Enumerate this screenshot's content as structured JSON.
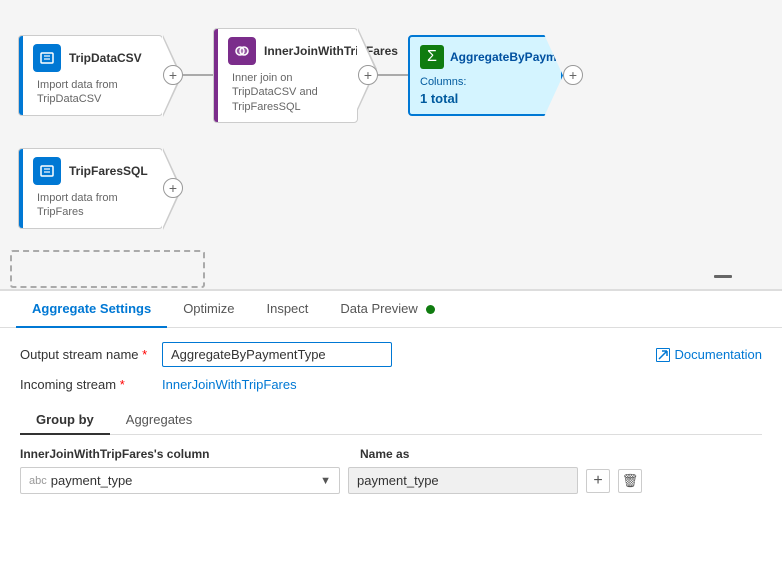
{
  "canvas": {
    "nodes": [
      {
        "id": "trip-data-csv",
        "title": "TripDataCSV",
        "subtitle": "Import data from TripDataCSV",
        "icon_type": "blue"
      },
      {
        "id": "inner-join",
        "title": "InnerJoinWithTripFares",
        "subtitle": "Inner join on TripDataCSV and TripFaresSQL",
        "icon_type": "purple"
      },
      {
        "id": "aggregate",
        "title": "AggregateByPaymentTy...",
        "subtitle_label": "Columns:",
        "subtitle_value": "1 total",
        "icon_type": "green"
      },
      {
        "id": "trip-fares-sql",
        "title": "TripFaresSQL",
        "subtitle": "Import data from TripFares",
        "icon_type": "blue"
      }
    ]
  },
  "bottom_panel": {
    "tabs": [
      {
        "id": "aggregate-settings",
        "label": "Aggregate Settings",
        "active": true
      },
      {
        "id": "optimize",
        "label": "Optimize",
        "active": false
      },
      {
        "id": "inspect",
        "label": "Inspect",
        "active": false
      },
      {
        "id": "data-preview",
        "label": "Data Preview",
        "active": false,
        "has_dot": true
      }
    ],
    "fields": {
      "output_stream_name_label": "Output stream name",
      "output_stream_name_value": "AggregateByPaymentType",
      "incoming_stream_label": "Incoming stream",
      "incoming_stream_value": "InnerJoinWithTripFares",
      "documentation_label": "Documentation"
    },
    "sub_tabs": [
      {
        "id": "group-by",
        "label": "Group by",
        "active": true
      },
      {
        "id": "aggregates",
        "label": "Aggregates",
        "active": false
      }
    ],
    "group_by": {
      "column_header": "InnerJoinWithTripFares's column",
      "name_as_header": "Name as",
      "dropdown_prefix": "abc",
      "dropdown_value": "payment_type",
      "name_value": "payment_type",
      "add_btn_label": "+",
      "delete_btn_label": "🗑"
    }
  }
}
